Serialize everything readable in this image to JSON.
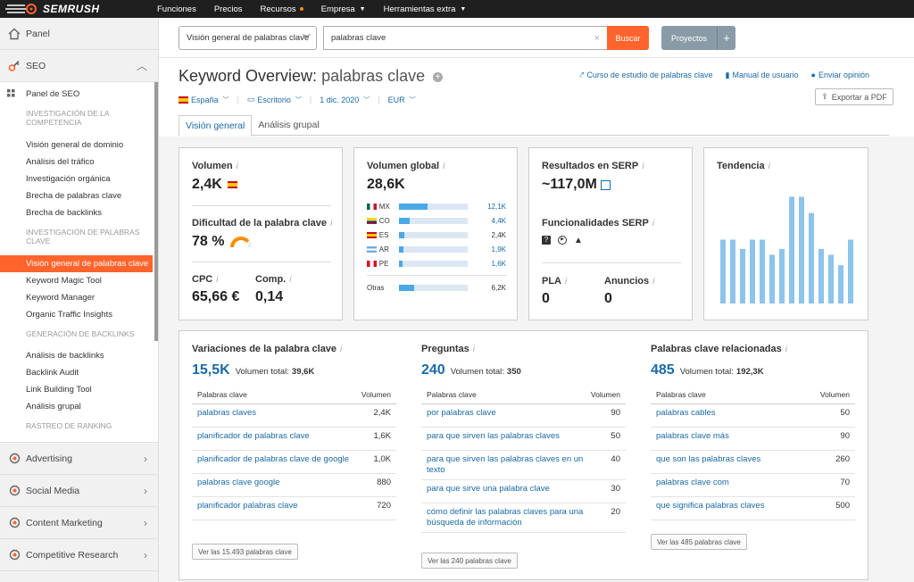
{
  "brand": "SEMRUSH",
  "topnav": [
    {
      "label": "Funciones",
      "dot": false,
      "caret": false
    },
    {
      "label": "Precios",
      "dot": false,
      "caret": false
    },
    {
      "label": "Recursos",
      "dot": true,
      "caret": false
    },
    {
      "label": "Empresa",
      "dot": false,
      "caret": true
    },
    {
      "label": "Herramientas extra",
      "dot": false,
      "caret": true
    }
  ],
  "sidebar": {
    "panel": "Panel",
    "seo": "SEO",
    "seo_panel": "Panel de SEO",
    "sec1": "INVESTIGACIÓN DE LA COMPETENCIA",
    "sec1_items": [
      "Visión general de dominio",
      "Análisis del tráfico",
      "Investigación orgánica",
      "Brecha de palabras clave",
      "Brecha de backlinks"
    ],
    "sec2": "INVESTIGACIÓN DE PALABRAS CLAVE",
    "sec2_items": [
      "Visión general de palabras clave",
      "Keyword Magic Tool",
      "Keyword Manager",
      "Organic Traffic Insights"
    ],
    "sec3": "GENERACIÓN DE BACKLINKS",
    "sec3_items": [
      "Análisis de backlinks",
      "Backlink Audit",
      "Link Building Tool",
      "Análisis grupal"
    ],
    "sec4": "RASTREO DE RANKING",
    "bottom": [
      "Advertising",
      "Social Media",
      "Content Marketing",
      "Competitive Research"
    ]
  },
  "search": {
    "database": "Visión general de palabras clave",
    "query": "palabras clave",
    "button": "Buscar",
    "projects": "Proyectos"
  },
  "header": {
    "title": "Keyword Overview:",
    "keyword": "palabras clave",
    "links": [
      "Curso de estudio de palabras clave",
      "Manual de usuario",
      "Enviar opinión"
    ],
    "export": "Exportar a PDF",
    "filters": {
      "country": "España",
      "device": "Escritorio",
      "date": "1 dic. 2020",
      "currency": "EUR"
    },
    "tabs": [
      "Visión general",
      "Análisis grupal"
    ]
  },
  "volume": {
    "label": "Volumen",
    "value": "2,4K"
  },
  "difficulty": {
    "label": "Dificultad de la palabra clave",
    "value": "78 %",
    "level": 0.78
  },
  "cpc": {
    "label": "CPC",
    "value": "65,66 €"
  },
  "comp": {
    "label": "Comp.",
    "value": "0,14"
  },
  "global": {
    "label": "Volumen global",
    "value": "28,6K",
    "rows": [
      {
        "code": "MX",
        "value": "12,1K",
        "link": true,
        "fill": 0.42
      },
      {
        "code": "CO",
        "value": "4,4K",
        "link": true,
        "fill": 0.15
      },
      {
        "code": "ES",
        "value": "2,4K",
        "link": false,
        "fill": 0.08
      },
      {
        "code": "AR",
        "value": "1,9K",
        "link": true,
        "fill": 0.06
      },
      {
        "code": "PE",
        "value": "1,6K",
        "link": true,
        "fill": 0.05
      }
    ],
    "other_label": "Otras",
    "other_value": "6,2K",
    "other_fill": 0.22
  },
  "serp": {
    "label": "Resultados en SERP",
    "value": "~117,0M",
    "features_label": "Funcionalidades SERP",
    "pla_label": "PLA",
    "pla_value": "0",
    "ads_label": "Anuncios",
    "ads_value": "0"
  },
  "trend": {
    "label": "Tendencia",
    "values": [
      0.55,
      0.55,
      0.47,
      0.55,
      0.55,
      0.42,
      0.47,
      0.92,
      0.92,
      0.78,
      0.47,
      0.42,
      0.33,
      0.55
    ]
  },
  "variations": {
    "label": "Variaciones de la palabra clave",
    "count": "15,5K",
    "total_label": "Volumen total:",
    "total": "39,6K",
    "col1": "Palabras clave",
    "col2": "Volumen",
    "rows": [
      {
        "kw": "palabras claves",
        "vol": "2,4K"
      },
      {
        "kw": "planificador de palabras clave",
        "vol": "1,6K"
      },
      {
        "kw": "planificador de palabras clave de google",
        "vol": "1,0K"
      },
      {
        "kw": "palabras clave google",
        "vol": "880"
      },
      {
        "kw": "planificador palabras clave",
        "vol": "720"
      }
    ],
    "button": "Ver las 15.493 palabras clave"
  },
  "questions": {
    "label": "Preguntas",
    "count": "240",
    "total_label": "Volumen total:",
    "total": "350",
    "col1": "Palabras clave",
    "col2": "Volumen",
    "rows": [
      {
        "kw": "por palabras clave",
        "vol": "90"
      },
      {
        "kw": "para que sirven las palabras claves",
        "vol": "50"
      },
      {
        "kw": "para que sirven las palabras claves en un texto",
        "vol": "40"
      },
      {
        "kw": "para que sirve una palabra clave",
        "vol": "30"
      },
      {
        "kw": "cómo definir las palabras claves para una búsqueda de información",
        "vol": "20"
      }
    ],
    "button": "Ver las 240 palabras clave"
  },
  "related": {
    "label": "Palabras clave relacionadas",
    "count": "485",
    "total_label": "Volumen total:",
    "total": "192,3K",
    "col1": "Palabras clave",
    "col2": "Volumen",
    "rows": [
      {
        "kw": "palabras cables",
        "vol": "50"
      },
      {
        "kw": "palabras clave más",
        "vol": "90"
      },
      {
        "kw": "que son las palabras claves",
        "vol": "260"
      },
      {
        "kw": "palabras clave com",
        "vol": "70"
      },
      {
        "kw": "que significa palabras claves",
        "vol": "500"
      }
    ],
    "button": "Ver las 485 palabras clave"
  },
  "colors": {
    "accent": "#ff642d",
    "link": "#1a6aa6",
    "bar": "#4aa8e8"
  }
}
